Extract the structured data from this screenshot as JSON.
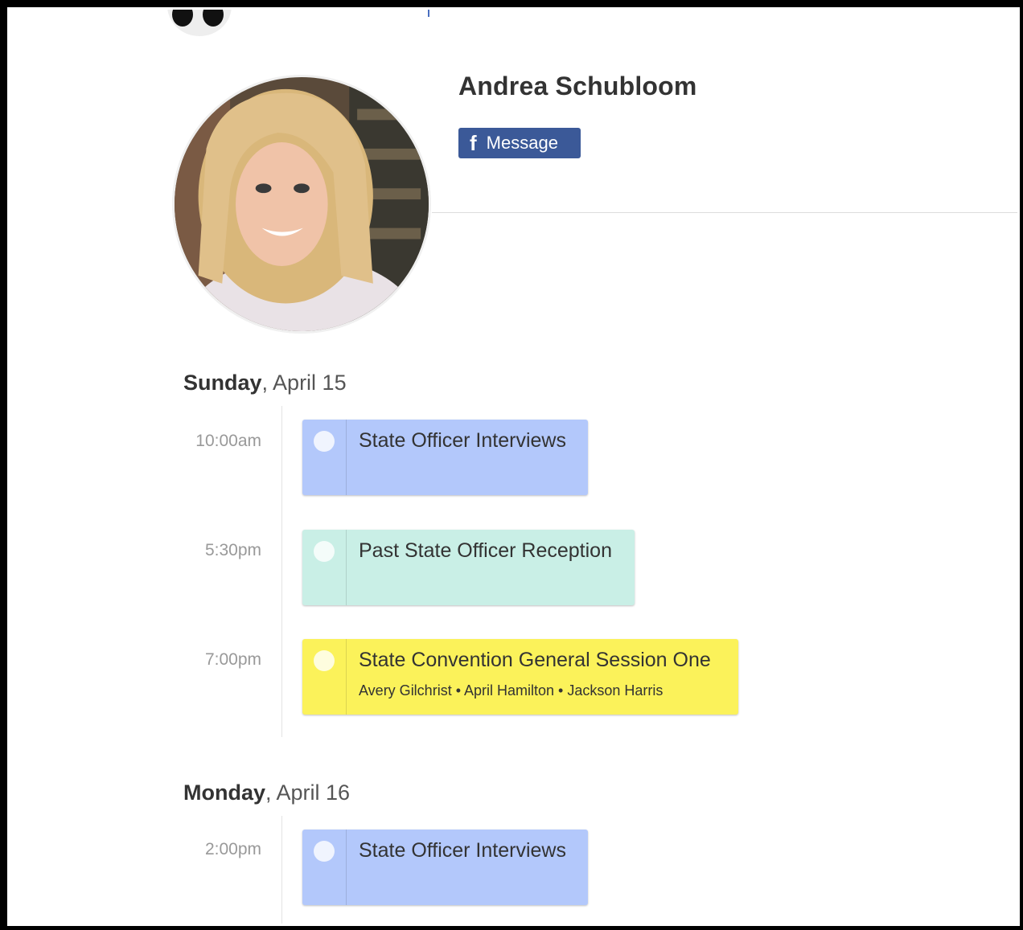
{
  "profile": {
    "name": "Andrea Schubloom",
    "message_label": "Message"
  },
  "days": [
    {
      "weekday": "Sunday",
      "date": ", April 15",
      "events": [
        {
          "time": "10:00am",
          "title": "State Officer Interviews",
          "people": "",
          "color": "#b3c8fb"
        },
        {
          "time": "5:30pm",
          "title": "Past State Officer Reception",
          "people": "",
          "color": "#c9efe6"
        },
        {
          "time": "7:00pm",
          "title": "State Convention General Session One",
          "people": "Avery Gilchrist • April Hamilton • Jackson Harris",
          "color": "#fbf25a"
        }
      ]
    },
    {
      "weekday": "Monday",
      "date": ", April 16",
      "events": [
        {
          "time": "2:00pm",
          "title": "State Officer Interviews",
          "people": "",
          "color": "#b3c8fb"
        }
      ]
    }
  ]
}
